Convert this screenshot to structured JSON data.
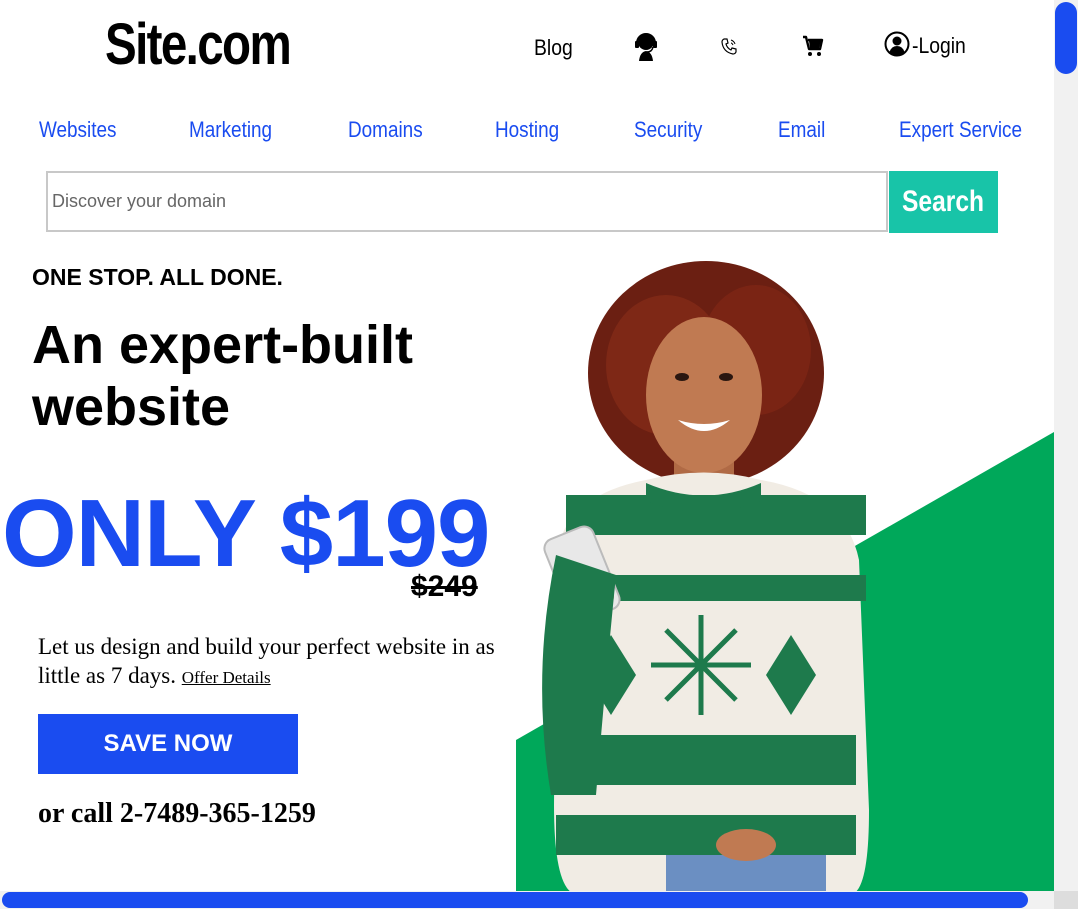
{
  "header": {
    "logo": "Site.com",
    "blog_label": "Blog",
    "support_icon": "support-agent-icon",
    "phone_icon": "phone-icon",
    "cart_icon": "cart-icon",
    "login_icon": "user-icon",
    "login_label": "-Login"
  },
  "menu": {
    "items": [
      {
        "label": "Websites"
      },
      {
        "label": "Marketing"
      },
      {
        "label": "Domains"
      },
      {
        "label": "Hosting"
      },
      {
        "label": "Security"
      },
      {
        "label": "Email"
      },
      {
        "label": "Expert Service"
      }
    ]
  },
  "search": {
    "placeholder": "Discover your domain",
    "value": "",
    "button_label": "Search"
  },
  "hero": {
    "eyebrow": "ONE STOP. ALL DONE.",
    "headline": "An expert-built website",
    "price": "ONLY $199",
    "old_price": "$249",
    "description": "Let us design and build your perfect website in as little as 7 days.",
    "offer_link": "Offer Details",
    "cta_label": "SAVE NOW",
    "call_text": "or call 2-7489-365-1259"
  },
  "colors": {
    "brand_blue": "#1a4cf0",
    "search_teal": "#18c4a8",
    "hero_green": "#00a85a"
  }
}
